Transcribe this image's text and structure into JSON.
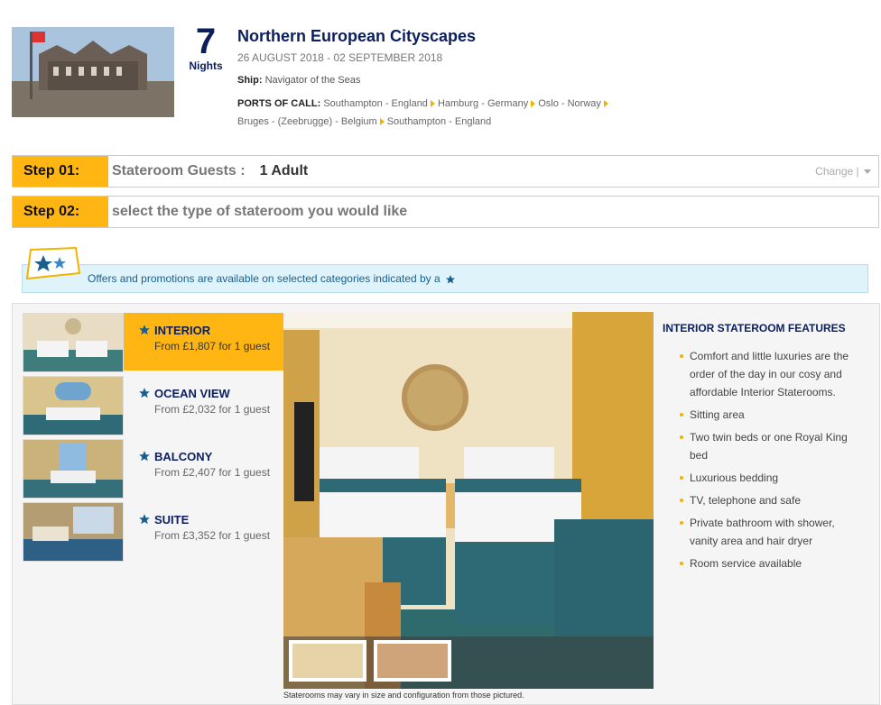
{
  "header": {
    "nights_number": "7",
    "nights_label": "Nights",
    "title": "Northern European Cityscapes",
    "dates": "26 AUGUST 2018 - 02 SEPTEMBER 2018",
    "ship_label": "Ship:",
    "ship_name": "Navigator of the Seas",
    "ports_label": "PORTS OF CALL:",
    "ports": [
      "Southampton - England",
      "Hamburg - Germany",
      "Oslo - Norway",
      "Bruges - (Zeebrugge) - Belgium",
      "Southampton - England"
    ]
  },
  "step1": {
    "tag": "Step 01:",
    "label": "Stateroom Guests :",
    "value": "1 Adult",
    "change": "Change |"
  },
  "step2": {
    "tag": "Step 02:",
    "label": "select the type of stateroom you would like"
  },
  "offers": {
    "text": "Offers and promotions are available on selected categories indicated by a"
  },
  "rooms": [
    {
      "name": "INTERIOR",
      "price": "From £1,807 for 1 guest"
    },
    {
      "name": "OCEAN VIEW",
      "price": "From £2,032 for 1 guest"
    },
    {
      "name": "BALCONY",
      "price": "From £2,407 for 1 guest"
    },
    {
      "name": "SUITE",
      "price": "From £3,352 for 1 guest"
    }
  ],
  "caption": "Staterooms may vary in size and configuration from those pictured.",
  "features": {
    "title": "INTERIOR STATEROOM FEATURES",
    "items": [
      "Comfort and little luxuries are the order of the day in our cosy and affordable Interior Staterooms.",
      "Sitting area",
      "Two twin beds or one Royal King bed",
      "Luxurious bedding",
      "TV, telephone and safe",
      "Private bathroom with shower, vanity area and hair dryer",
      "Room service available"
    ]
  },
  "colors": {
    "accent": "#ffb612",
    "navy": "#0b1f5c",
    "star": "#1b5e8e"
  }
}
